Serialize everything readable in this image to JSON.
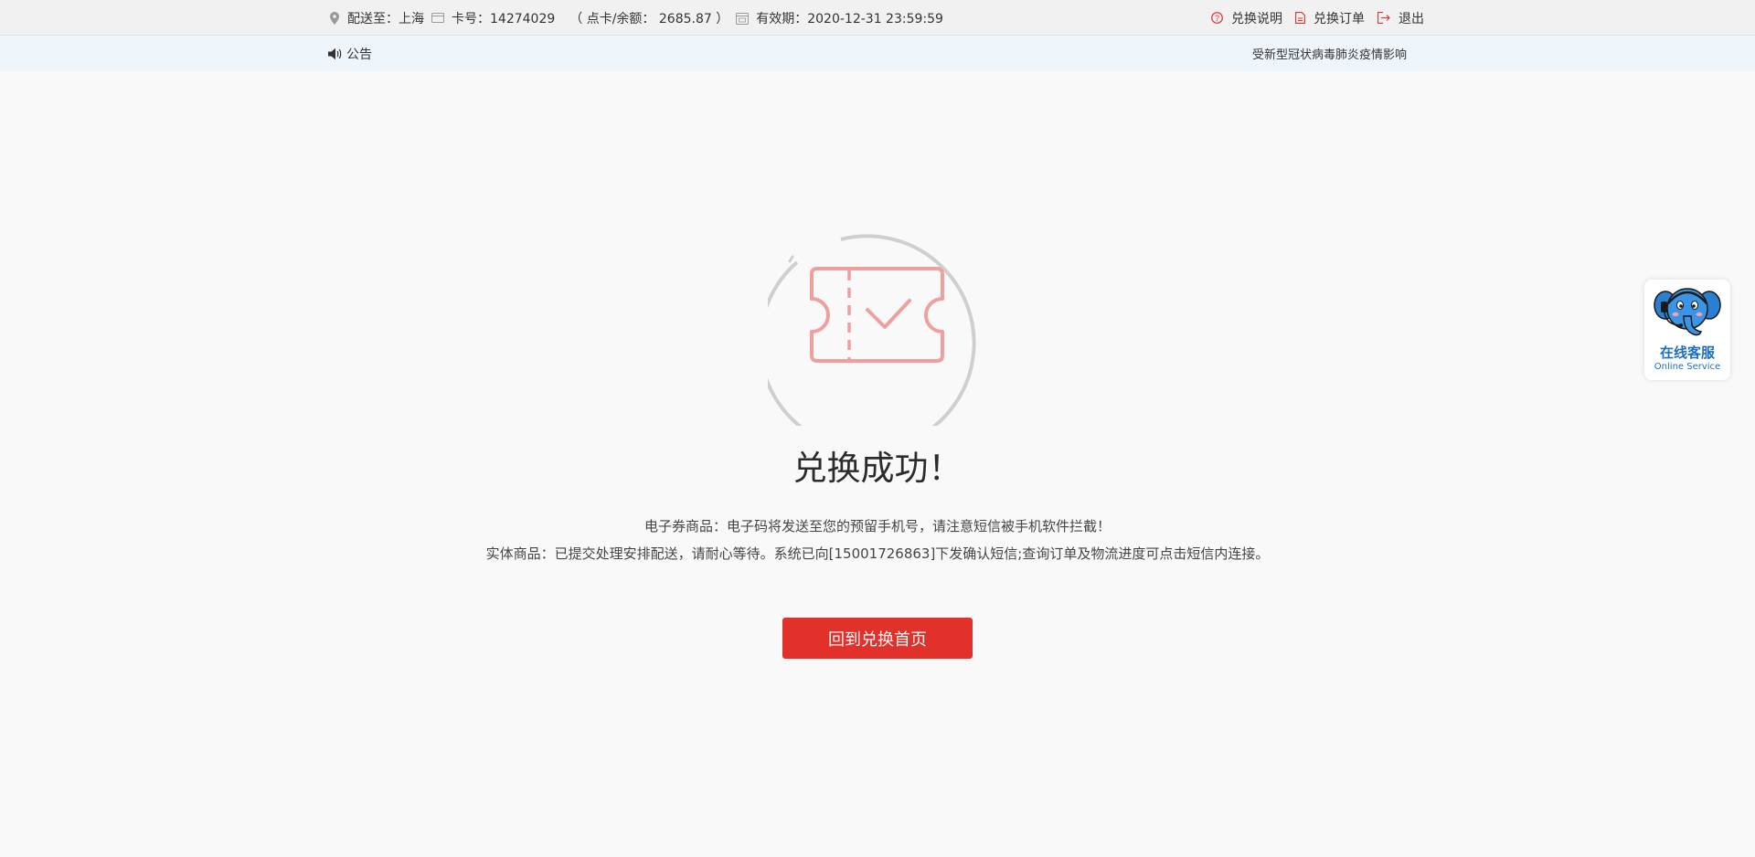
{
  "topbar": {
    "delivery_label": "配送至：上海",
    "card_label": "卡号：14274029",
    "balance_label": "（ 点卡/余额：  2685.87 ）",
    "validity_label": "有效期：2020-12-31 23:59:59",
    "help_label": "兑换说明",
    "orders_label": "兑换订单",
    "logout_label": "退出"
  },
  "notice": {
    "label": "公告",
    "scroll_text": "受新型冠状病毒肺炎疫情影响"
  },
  "result": {
    "title": "兑换成功！",
    "message_ecoupon": "电子券商品：电子码将发送至您的预留手机号，请注意短信被手机软件拦截！",
    "message_physical": "实体商品：已提交处理安排配送，请耐心等待。系统已向[15001726863]下发确认短信;查询订单及物流进度可点击短信内连接。",
    "button_label": "回到兑换首页"
  },
  "service_widget": {
    "label_cn": "在线客服",
    "label_en": "Online Service"
  },
  "colors": {
    "accent_red": "#e2302a",
    "ticket_pink": "#f0a09c",
    "service_blue": "#1e6fb8"
  },
  "icons": {
    "location": "location-pin-icon",
    "card": "card-icon",
    "calendar": "calendar-icon",
    "help": "question-circle-icon",
    "orders": "document-icon",
    "logout": "logout-icon",
    "speaker": "speaker-icon",
    "ticket": "ticket-check-icon",
    "mascot": "elephant-mascot-icon"
  }
}
